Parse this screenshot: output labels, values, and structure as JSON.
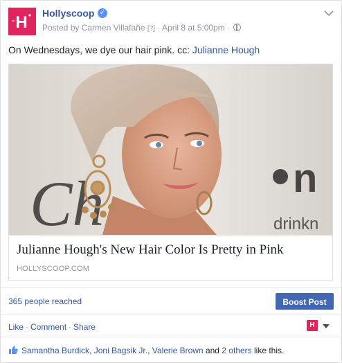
{
  "post": {
    "page_name": "Hollyscoop",
    "logo_letter": "H",
    "posted_by": "Posted by Carmen Villafañe",
    "help_mark": "[?]",
    "separator": "·",
    "timestamp": "April 8 at 5:00pm",
    "message_text": "On Wednesdays, we dye our hair pink. cc: ",
    "mention": "Julianne Hough",
    "verified_mark": "✓"
  },
  "link": {
    "title": "Julianne Hough's New Hair Color Is Pretty in Pink",
    "domain": "HOLLYSCOOP.COM",
    "image_texts": {
      "backdrop_word": "Ch",
      "brand_mark": "n",
      "brand_word": "drinkn"
    }
  },
  "stats": {
    "reach": "365 people reached",
    "boost_label": "Boost Post"
  },
  "actions": {
    "like": "Like",
    "comment": "Comment",
    "share": "Share",
    "dot": "·"
  },
  "likes": {
    "name1": "Samantha Burdick",
    "sep1": ", ",
    "name2": "Joni Bagsik Jr.",
    "sep2": ", ",
    "name3": "Valerie Brown",
    "and": " and ",
    "others": "2 others",
    "suffix": " like this."
  },
  "colors": {
    "brand": "#e0245e",
    "link": "#365899",
    "button": "#4267b2",
    "meta": "#90949c"
  },
  "icons": [
    "hollyscoop-logo",
    "verified-badge-icon",
    "globe-icon",
    "chevron-down-icon",
    "page-avatar-icon",
    "caret-down-icon",
    "thumbs-up-icon"
  ]
}
